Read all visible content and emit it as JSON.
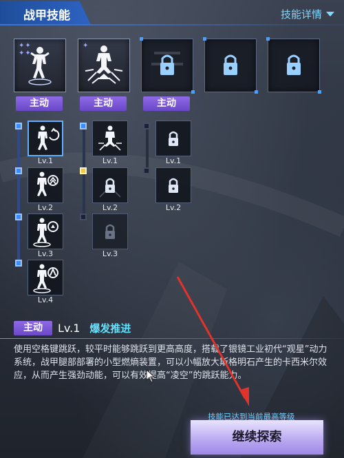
{
  "header": {
    "title": "战甲技能",
    "details_label": "技能详情"
  },
  "top_slots": [
    {
      "state": "unlocked",
      "icon": "jumping-figure-icon",
      "badge": "主动"
    },
    {
      "state": "unlocked",
      "icon": "burst-figure-icon",
      "badge": "主动"
    },
    {
      "state": "locked",
      "icon": "lock-icon",
      "badge": "主动"
    },
    {
      "state": "locked",
      "icon": "lock-icon",
      "badge": ""
    },
    {
      "state": "locked",
      "icon": "lock-icon",
      "badge": ""
    }
  ],
  "tree": {
    "column1": [
      {
        "label": "Lv.1",
        "state": "unlocked",
        "selected": true
      },
      {
        "label": "Lv.2",
        "state": "unlocked"
      },
      {
        "label": "Lv.3",
        "state": "unlocked"
      },
      {
        "label": "Lv.4",
        "state": "unlocked"
      }
    ],
    "column2": [
      {
        "label": "Lv.1",
        "state": "unlocked"
      },
      {
        "label": "Lv.2",
        "state": "locked"
      },
      {
        "label": "Lv.3",
        "state": "locked-dim"
      }
    ],
    "column3": [
      {
        "label": "Lv.1",
        "state": "locked"
      },
      {
        "label": "Lv.2",
        "state": "locked"
      }
    ]
  },
  "selected_skill": {
    "badge": "主动",
    "level": "Lv.1",
    "name": "爆发推进",
    "description": "使用空格键跳跃，较平时能够跳跃到更高高度，搭载了银镜工业初代“观星”动力系统，战甲腿部部署的小型燃熵装置，可以小幅放大斯格明石产生的卡西米尔效应，从而产生强劲动能，可以有效提高“凌空”的跳跃能力。"
  },
  "footer": {
    "max_level_text": "技能已达到当前最高等级",
    "continue_label": "继续探索"
  },
  "colors": {
    "accent": "#5fe1ff",
    "badge": "#7b5ad6",
    "header": "#2d63c2",
    "annotation_arrow": "#e0332c"
  }
}
